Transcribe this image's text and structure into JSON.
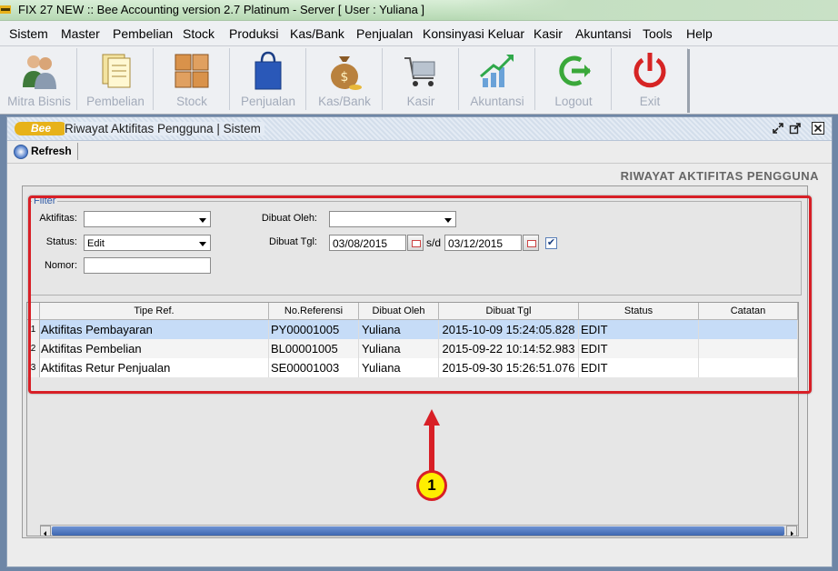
{
  "app": {
    "title": "FIX 27 NEW :: Bee Accounting version 2.7 Platinum - Server  [ User : Yuliana ]"
  },
  "menu": [
    "Sistem",
    "Master",
    "Pembelian",
    "Stock",
    "Produksi",
    "Kas/Bank",
    "Penjualan",
    "Konsinyasi Keluar",
    "Kasir",
    "Akuntansi",
    "Tools",
    "Help"
  ],
  "toolbar": [
    "Mitra Bisnis",
    "Pembelian",
    "Stock",
    "Penjualan",
    "Kas/Bank",
    "Kasir",
    "Akuntansi",
    "Logout",
    "Exit"
  ],
  "window": {
    "logo": "Bee",
    "title": "Riwayat Aktifitas Pengguna | Sistem",
    "refresh_label": "Refresh",
    "report_title": "RIWAYAT AKTIFITAS PENGGUNA"
  },
  "filter": {
    "legend": "Filter",
    "aktifitas_label": "Aktifitas:",
    "aktifitas_value": "",
    "status_label": "Status:",
    "status_value": "Edit",
    "nomor_label": "Nomor:",
    "nomor_value": "",
    "dibuat_oleh_label": "Dibuat Oleh:",
    "dibuat_oleh_value": "",
    "dibuat_tgl_label": "Dibuat Tgl:",
    "date_from": "03/08/2015",
    "date_sep": "s/d",
    "date_to": "03/12/2015",
    "date_checked": "✔"
  },
  "table": {
    "columns": [
      "Tipe Ref.",
      "No.Referensi",
      "Dibuat Oleh",
      "Dibuat Tgl",
      "Status",
      "Catatan"
    ],
    "rows": [
      {
        "no": "1",
        "tipe": "Aktifitas Pembayaran",
        "ref": "PY00001005",
        "oleh": "Yuliana",
        "tgl": "2015-10-09 15:24:05.828",
        "status": "EDIT",
        "catatan": ""
      },
      {
        "no": "2",
        "tipe": "Aktifitas Pembelian",
        "ref": "BL00001005",
        "oleh": "Yuliana",
        "tgl": "2015-09-22 10:14:52.983",
        "status": "EDIT",
        "catatan": ""
      },
      {
        "no": "3",
        "tipe": "Aktifitas Retur Penjualan",
        "ref": "SE00001003",
        "oleh": "Yuliana",
        "tgl": "2015-09-30 15:26:51.076",
        "status": "EDIT",
        "catatan": ""
      }
    ]
  },
  "annotation": {
    "badge": "1"
  },
  "colors": {
    "highlight": "#d81f26",
    "selected_row": "#c6dcf7",
    "badge": "#ffee00"
  }
}
